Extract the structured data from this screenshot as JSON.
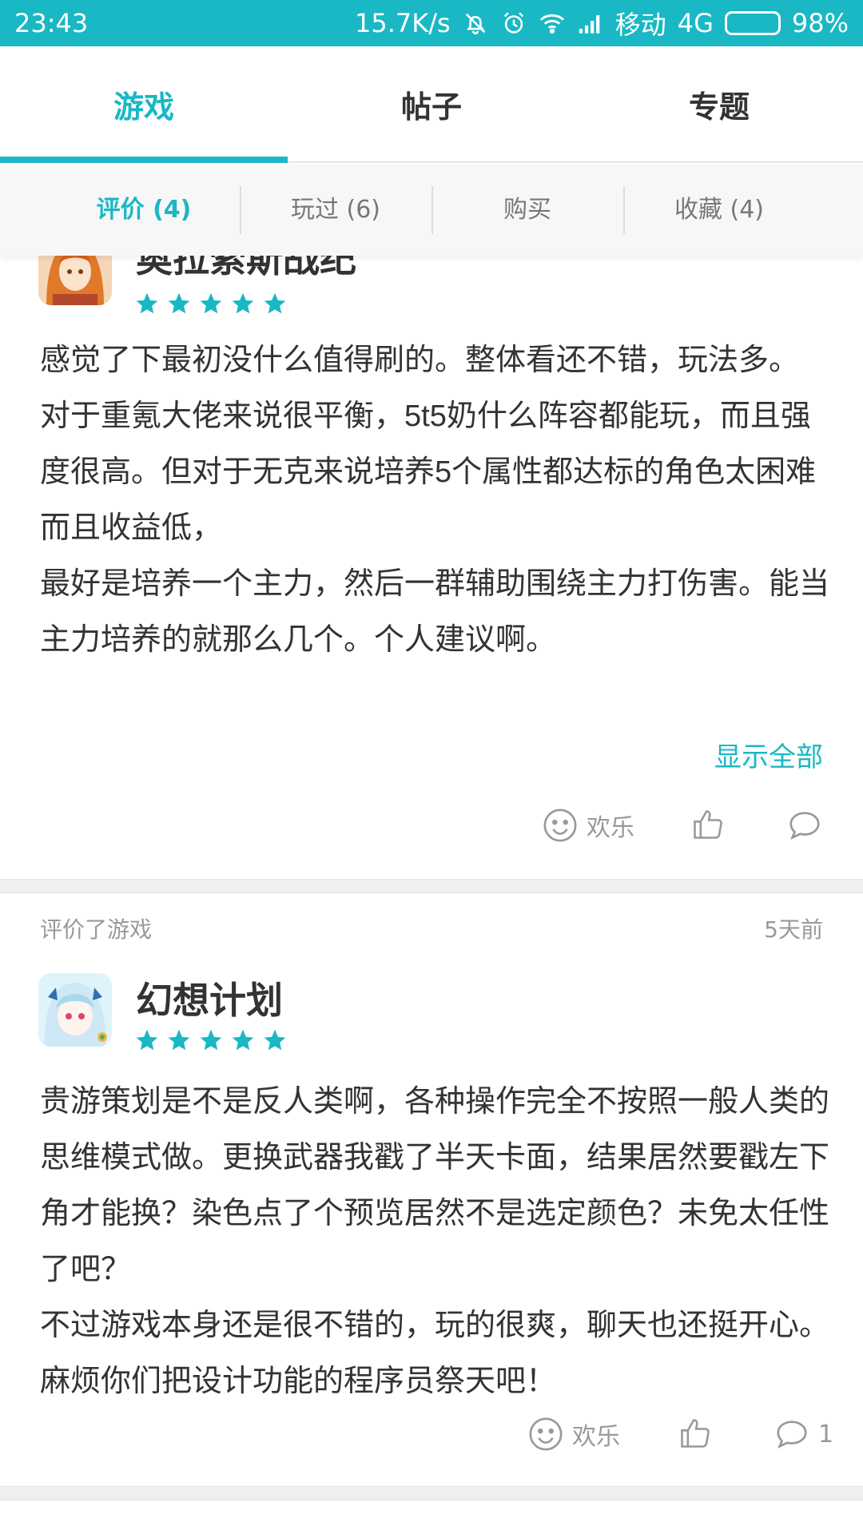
{
  "status_bar": {
    "time": "23:43",
    "speed": "15.7K/s",
    "carrier": "移动",
    "network": "4G",
    "battery": "98%",
    "battery_level": 0.98
  },
  "main_tabs": [
    {
      "label": "游戏",
      "active": true
    },
    {
      "label": "帖子",
      "active": false
    },
    {
      "label": "专题",
      "active": false
    }
  ],
  "sub_tabs": [
    {
      "label": "评价 (4)",
      "active": true
    },
    {
      "label": "玩过 (6)",
      "active": false
    },
    {
      "label": "购买",
      "active": false
    },
    {
      "label": "收藏 (4)",
      "active": false
    }
  ],
  "reviews": [
    {
      "game_name": "奥拉索斯战纪",
      "rating": 5,
      "paragraphs": [
        "感觉了下最初没什么值得刷的。整体看还不错，玩法多。",
        "对于重氪大佬来说很平衡，5t5奶什么阵容都能玩，而且强度很高。但对于无克来说培养5个属性都达标的角色太困难而且收益低，",
        "最好是培养一个主力，然后一群辅助围绕主力打伤害。能当主力培养的就那么几个。个人建议啊。"
      ],
      "show_all": "显示全部",
      "reaction": "欢乐",
      "comment_count": ""
    },
    {
      "meta_label": "评价了游戏",
      "time": "5天前",
      "game_name": "幻想计划",
      "rating": 5,
      "paragraphs": [
        "贵游策划是不是反人类啊，各种操作完全不按照一般人类的思维模式做。更换武器我戳了半天卡面，结果居然要戳左下角才能换？染色点了个预览居然不是选定颜色？未免太任性了吧？",
        "不过游戏本身还是很不错的，玩的很爽，聊天也还挺开心。麻烦你们把设计功能的程序员祭天吧！"
      ],
      "reaction": "欢乐",
      "comment_count": "1"
    }
  ],
  "colors": {
    "accent": "#19b8c4",
    "star": "#19b8c4",
    "text": "#333333",
    "muted": "#999999"
  },
  "icons": [
    "bell-off-icon",
    "alarm-icon",
    "wifi-icon",
    "signal-icon",
    "battery-icon",
    "star-icon",
    "smiley-icon",
    "thumb-up-icon",
    "comment-icon"
  ]
}
